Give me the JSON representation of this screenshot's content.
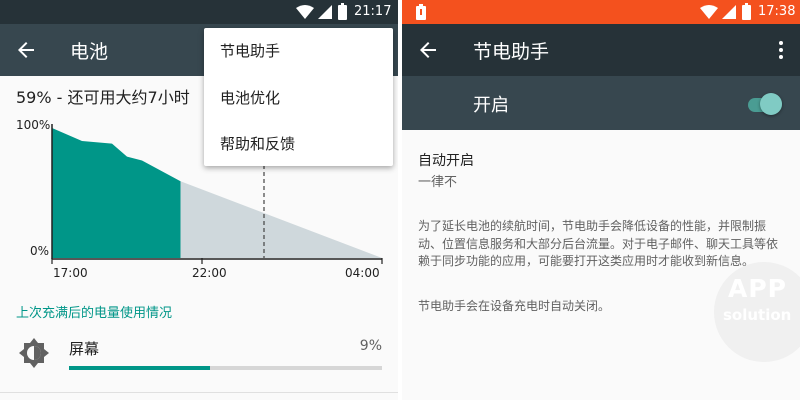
{
  "left": {
    "status_time": "21:17",
    "toolbar": {
      "title": "电池"
    },
    "summary": "59% - 还可用大约7小时",
    "chart_data": {
      "type": "area",
      "y_ticks": [
        "100%",
        "0%"
      ],
      "x_ticks": [
        "17:00",
        "22:00",
        "04:00"
      ],
      "actual_series": {
        "x": [
          "17:00",
          "18:00",
          "19:00",
          "19:30",
          "20:00",
          "21:17"
        ],
        "values": [
          100,
          90,
          88,
          78,
          75,
          59
        ]
      },
      "projected_series": {
        "x": [
          "21:17",
          "04:00"
        ],
        "values": [
          59,
          0
        ]
      },
      "colors": {
        "actual": "#009688",
        "projected": "#cfd8dc"
      }
    },
    "section_title": "上次充满后的电量使用情况",
    "usage": [
      {
        "icon": "brightness-icon",
        "name": "屏幕",
        "percent_label": "9%",
        "percent": 9
      }
    ],
    "menu": {
      "items": [
        "节电助手",
        "电池优化",
        "帮助和反馈"
      ]
    }
  },
  "right": {
    "status_time": "17:38",
    "toolbar": {
      "title": "节电助手"
    },
    "switch": {
      "label": "开启",
      "on": true
    },
    "pref": {
      "title": "自动开启",
      "summary": "一律不"
    },
    "description": "为了延长电池的续航时间，节电助手会降低设备的性能，并限制振动、位置信息服务和大部分后台流量。对于电子邮件、聊天工具等依赖于同步功能的应用，可能要打开这类应用时才能收到新信息。",
    "note": "节电助手会在设备充电时自动关闭。",
    "watermark": {
      "line1": "APP",
      "line2": "solution"
    }
  },
  "colors": {
    "accent": "#009688",
    "toolbar_left": "#37474f",
    "statusbar_right": "#f4511e",
    "toolbar_right": "#263238"
  }
}
